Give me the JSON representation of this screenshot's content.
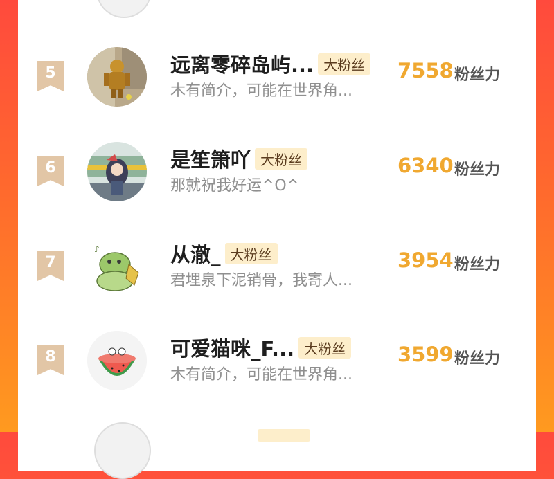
{
  "rows": [
    {
      "rank": "5",
      "name": "远离零碎岛屿...",
      "badge": "大粉丝",
      "bio": "木有简介，可能在世界角...",
      "score": "7558",
      "unit": "粉丝力",
      "avatar": "gold-robot-figure-avatar"
    },
    {
      "rank": "6",
      "name": "是笙箫吖",
      "badge": "大粉丝",
      "bio": "那就祝我好运^O^",
      "score": "6340",
      "unit": "粉丝力",
      "avatar": "anime-character-avatar"
    },
    {
      "rank": "7",
      "name": "从澈_",
      "badge": "大粉丝",
      "bio": "君埋泉下泥销骨，我寄人...",
      "score": "3954",
      "unit": "粉丝力",
      "avatar": "green-frog-cartoon-avatar"
    },
    {
      "rank": "8",
      "name": "可爱猫咪_F...",
      "badge": "大粉丝",
      "bio": "木有简介，可能在世界角...",
      "score": "3599",
      "unit": "粉丝力",
      "avatar": "watermelon-bowl-avatar"
    }
  ]
}
